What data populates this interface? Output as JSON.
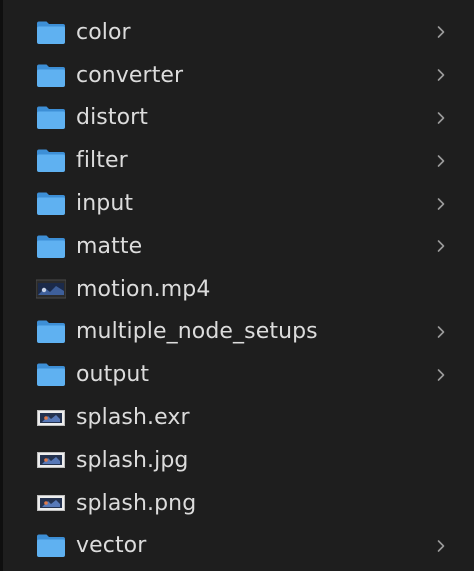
{
  "colors": {
    "background": "#1e1e1e",
    "text": "#dcdcdc",
    "folder_front": "#5fb1f1",
    "folder_back": "#3d8fd6",
    "chevron": "#9a9a9a"
  },
  "items": [
    {
      "name": "color",
      "kind": "folder",
      "expandable": true
    },
    {
      "name": "converter",
      "kind": "folder",
      "expandable": true
    },
    {
      "name": "distort",
      "kind": "folder",
      "expandable": true
    },
    {
      "name": "filter",
      "kind": "folder",
      "expandable": true
    },
    {
      "name": "input",
      "kind": "folder",
      "expandable": true
    },
    {
      "name": "matte",
      "kind": "folder",
      "expandable": true
    },
    {
      "name": "motion.mp4",
      "kind": "video",
      "expandable": false
    },
    {
      "name": "multiple_node_setups",
      "kind": "folder",
      "expandable": true
    },
    {
      "name": "output",
      "kind": "folder",
      "expandable": true
    },
    {
      "name": "splash.exr",
      "kind": "image",
      "expandable": false
    },
    {
      "name": "splash.jpg",
      "kind": "image",
      "expandable": false
    },
    {
      "name": "splash.png",
      "kind": "image",
      "expandable": false
    },
    {
      "name": "vector",
      "kind": "folder",
      "expandable": true
    }
  ]
}
